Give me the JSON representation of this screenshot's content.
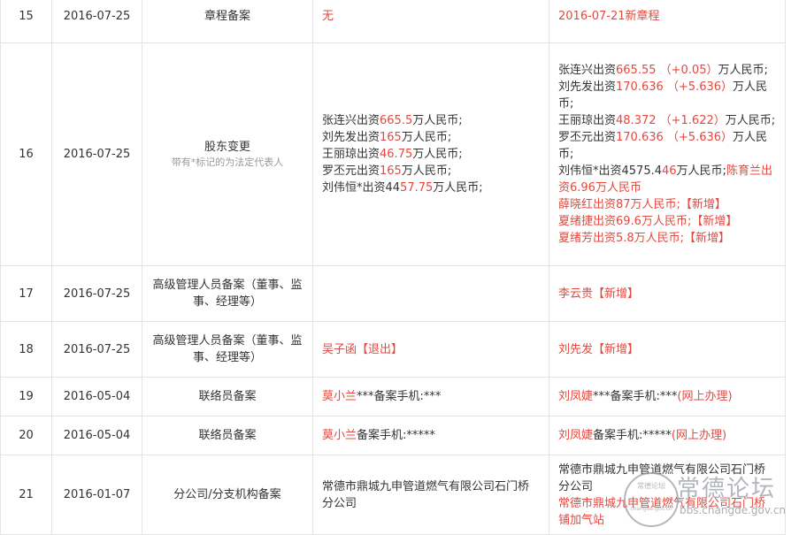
{
  "rows": [
    {
      "no": "15",
      "date": "2016-07-25",
      "item": "章程备案",
      "hint": "",
      "before": [
        {
          "t": "无",
          "r": true
        }
      ],
      "after": [
        {
          "t": "2016-07-21新章程",
          "r": true
        }
      ]
    },
    {
      "no": "16",
      "date": "2016-07-25",
      "item": "股东变更",
      "hint": "带有*标记的为法定代表人",
      "before": [
        {
          "t": "张连兴出资",
          "r": false
        },
        {
          "t": "665.5",
          "r": true
        },
        {
          "t": "万人民币;",
          "r": false,
          "br": true
        },
        {
          "t": "刘先发出资",
          "r": false
        },
        {
          "t": "165",
          "r": true
        },
        {
          "t": "万人民币;",
          "r": false,
          "br": true
        },
        {
          "t": "王丽琼出资",
          "r": false
        },
        {
          "t": "46.75",
          "r": true
        },
        {
          "t": "万人民币;",
          "r": false,
          "br": true
        },
        {
          "t": "罗丕元出资",
          "r": false
        },
        {
          "t": "165",
          "r": true
        },
        {
          "t": "万人民币;",
          "r": false,
          "br": true
        },
        {
          "t": "刘伟恒*出资44",
          "r": false
        },
        {
          "t": "57.75",
          "r": true
        },
        {
          "t": "万人民币;",
          "r": false
        }
      ],
      "after": [
        {
          "t": "张连兴出资",
          "r": false
        },
        {
          "t": "665.55 （+0.05）",
          "r": true
        },
        {
          "t": "万人民币;",
          "r": false,
          "br": true
        },
        {
          "t": "刘先发出资",
          "r": false
        },
        {
          "t": "170.636 （+5.636）",
          "r": true
        },
        {
          "t": "万人民币;",
          "r": false,
          "br": true
        },
        {
          "t": "王丽琼出资",
          "r": false
        },
        {
          "t": "48.372 （+1.622）",
          "r": true
        },
        {
          "t": "万人民币;",
          "r": false,
          "br": true
        },
        {
          "t": "罗丕元出资",
          "r": false
        },
        {
          "t": "170.636 （+5.636）",
          "r": true
        },
        {
          "t": "万人民币;",
          "r": false,
          "br": true
        },
        {
          "t": "刘伟恒*出资4575.4",
          "r": false
        },
        {
          "t": "46",
          "r": true
        },
        {
          "t": "万人民币;",
          "r": false
        },
        {
          "t": "陈育兰出资6.96万人民币",
          "r": true,
          "br": true
        },
        {
          "t": "薛晓红出资87万人民币;【新增】",
          "r": true,
          "br": true
        },
        {
          "t": "夏绪捷出资69.6万人民币;【新增】",
          "r": true,
          "br": true
        },
        {
          "t": "夏绪芳出资5.8万人民币;【新增】",
          "r": true
        }
      ]
    },
    {
      "no": "17",
      "date": "2016-07-25",
      "item": "高级管理人员备案（董事、监事、经理等）",
      "hint": "",
      "before": [],
      "after": [
        {
          "t": "李云贵【新增】",
          "r": true
        }
      ]
    },
    {
      "no": "18",
      "date": "2016-07-25",
      "item": "高级管理人员备案（董事、监事、经理等）",
      "hint": "",
      "before": [
        {
          "t": "吴子函【退出】",
          "r": true
        }
      ],
      "after": [
        {
          "t": "刘先发【新增】",
          "r": true
        }
      ]
    },
    {
      "no": "19",
      "date": "2016-05-04",
      "item": "联络员备案",
      "hint": "",
      "before": [
        {
          "t": "莫小兰",
          "r": true
        },
        {
          "t": "***备案手机:***",
          "r": false
        }
      ],
      "after": [
        {
          "t": "刘凤婕",
          "r": true
        },
        {
          "t": "***备案手机:***",
          "r": false
        },
        {
          "t": "(网上办理)",
          "r": true
        }
      ]
    },
    {
      "no": "20",
      "date": "2016-05-04",
      "item": "联络员备案",
      "hint": "",
      "before": [
        {
          "t": "莫小兰",
          "r": true
        },
        {
          "t": "备案手机:*****",
          "r": false
        }
      ],
      "after": [
        {
          "t": "刘凤婕",
          "r": true
        },
        {
          "t": "备案手机:*****",
          "r": false
        },
        {
          "t": "(网上办理)",
          "r": true
        }
      ]
    },
    {
      "no": "21",
      "date": "2016-01-07",
      "item": "分公司/分支机构备案",
      "hint": "",
      "before": [
        {
          "t": "常德市鼎城九申管道燃气有限公司石门桥分公司",
          "r": false
        }
      ],
      "after": [
        {
          "t": "常德市鼎城九申管道燃气有限公司石门桥分公司",
          "r": false,
          "br": true
        },
        {
          "t": "常德市鼎城九申管道燃气有限公司石门桥铺加气站",
          "r": true
        }
      ]
    }
  ],
  "watermark": {
    "title": "常德论坛",
    "url": "bbs.changde.gov.cn",
    "seal_text": "常德论坛"
  }
}
